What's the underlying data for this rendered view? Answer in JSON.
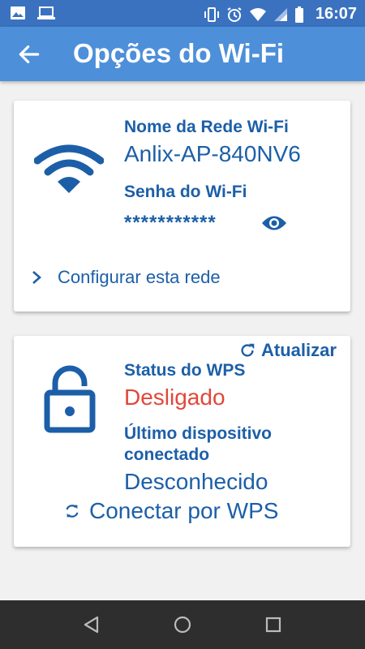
{
  "status_bar": {
    "time": "16:07"
  },
  "app_bar": {
    "title": "Opções do Wi-Fi"
  },
  "network_card": {
    "name_label": "Nome da Rede Wi-Fi",
    "name_value": "Anlix-AP-840NV6",
    "password_label": "Senha do Wi-Fi",
    "password_value": "***********",
    "configure_link": "Configurar esta rede"
  },
  "wps_card": {
    "refresh_label": "Atualizar",
    "status_label": "Status do WPS",
    "status_value": "Desligado",
    "last_device_label_line1": "Último dispositivo",
    "last_device_label_line2": "conectado",
    "last_device_value": "Desconhecido",
    "connect_button": "Conectar por WPS"
  },
  "colors": {
    "primary": "#4d8fd9",
    "statusbar": "#3a72c0",
    "text_blue": "#1c5fa8",
    "status_off_red": "#e0483a"
  }
}
